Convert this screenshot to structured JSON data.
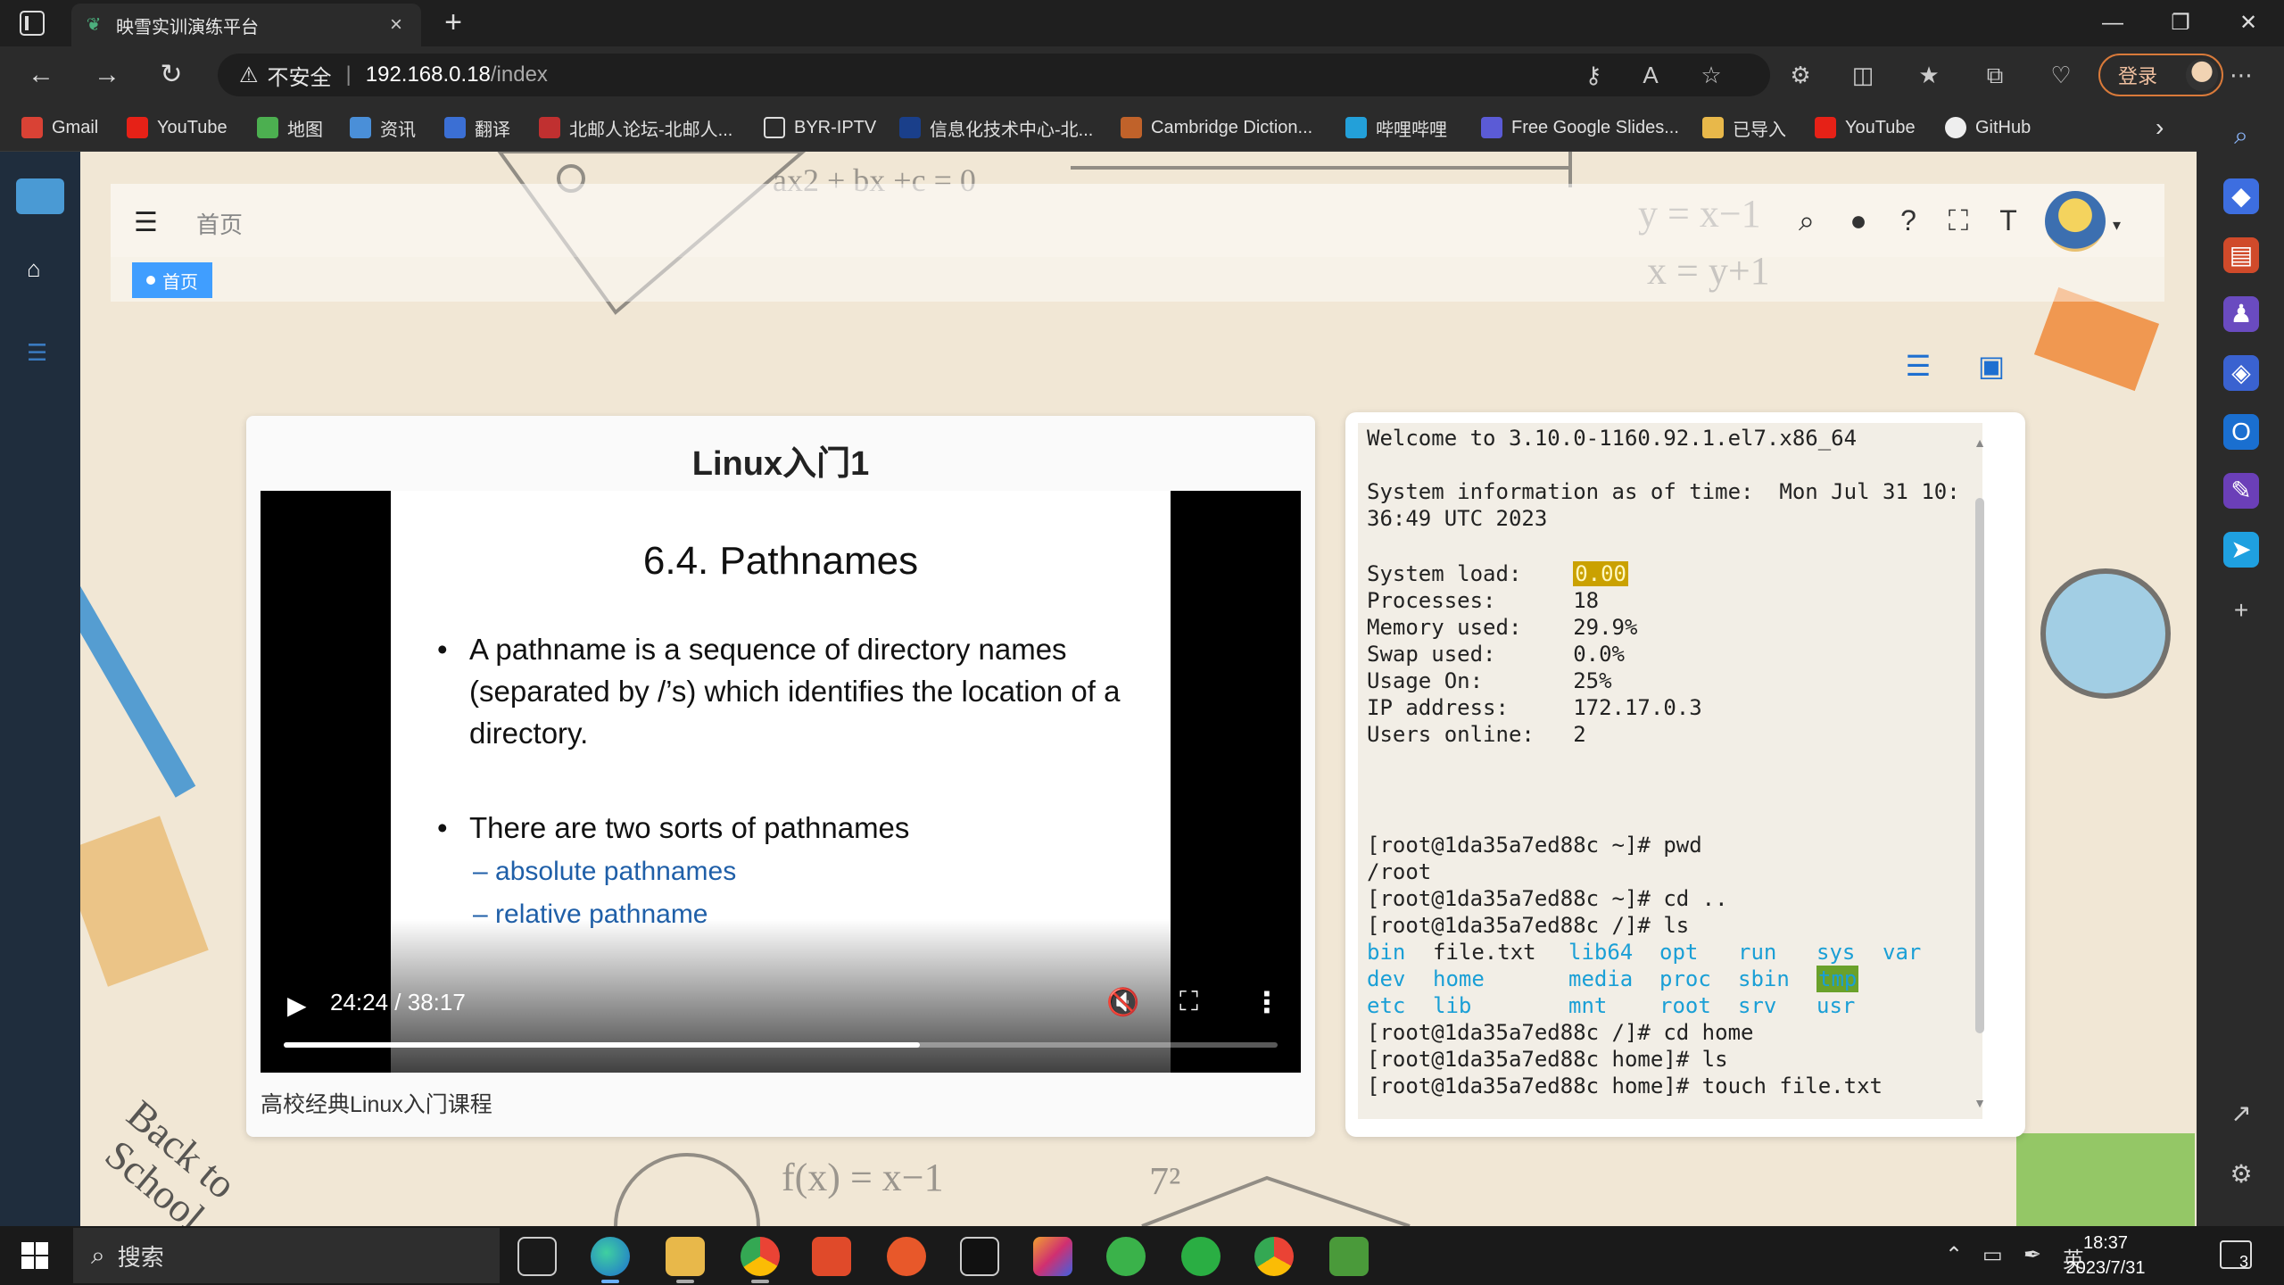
{
  "browser": {
    "tab_title": "映雪实训演练平台",
    "url_warning": "不安全",
    "url_host": "192.168.0.18",
    "url_path": "/index",
    "login_label": "登录",
    "bookmarks": [
      "Gmail",
      "YouTube",
      "地图",
      "资讯",
      "翻译",
      "北邮人论坛-北邮人...",
      "BYR-IPTV",
      "信息化技术中心-北...",
      "Cambridge Diction...",
      "哔哩哔哩",
      "Free Google Slides...",
      "已导入",
      "YouTube",
      "GitHub"
    ]
  },
  "app": {
    "breadcrumb": "首页",
    "tag_home": "首页"
  },
  "video": {
    "title": "Linux入门1",
    "slide_heading": "6.4. Pathnames",
    "bullet1": "A pathname is a sequence of directory names (separated by /’s) which identifies the location of a directory.",
    "bullet2": "There are two sorts of pathnames",
    "sub1": "– absolute pathnames",
    "sub2": "– relative pathname",
    "time": "24:24 / 38:17",
    "progress": 0.64,
    "caption": "高校经典Linux入门课程"
  },
  "terminal": {
    "welcome": "Welcome to 3.10.0-1160.92.1.el7.x86_64",
    "sysinfo1": "System information as of time:  Mon Jul 31 10:",
    "sysinfo2": "36:49 UTC 2023",
    "load_label": "System load:    ",
    "load_value": "0.00",
    "processes": "Processes:      18",
    "memory": "Memory used:    29.9%",
    "swap": "Swap used:      0.0%",
    "usage": "Usage On:       25%",
    "ip": "IP address:     172.17.0.3",
    "users": "Users online:   2",
    "cmd1": "[root@1da35a7ed88c ~]# pwd",
    "out1": "/root",
    "cmd2": "[root@1da35a7ed88c ~]# cd ..",
    "cmd3": "[root@1da35a7ed88c /]# ls",
    "ls_row1": [
      "bin",
      "file.txt",
      "lib64",
      "opt",
      "run",
      "sys",
      "var"
    ],
    "ls_row2": [
      "dev",
      "home",
      "media",
      "proc",
      "sbin",
      "tmp"
    ],
    "ls_row3": [
      "etc",
      "lib",
      "mnt",
      "root",
      "srv",
      "usr"
    ],
    "cmd4": "[root@1da35a7ed88c /]# cd home",
    "cmd5": "[root@1da35a7ed88c home]# ls",
    "cmd6": "[root@1da35a7ed88c home]# touch file.txt"
  },
  "taskbar": {
    "search_placeholder": "搜索",
    "ime": "英",
    "time": "18:37",
    "date": "2023/7/31",
    "notifications": "3"
  }
}
